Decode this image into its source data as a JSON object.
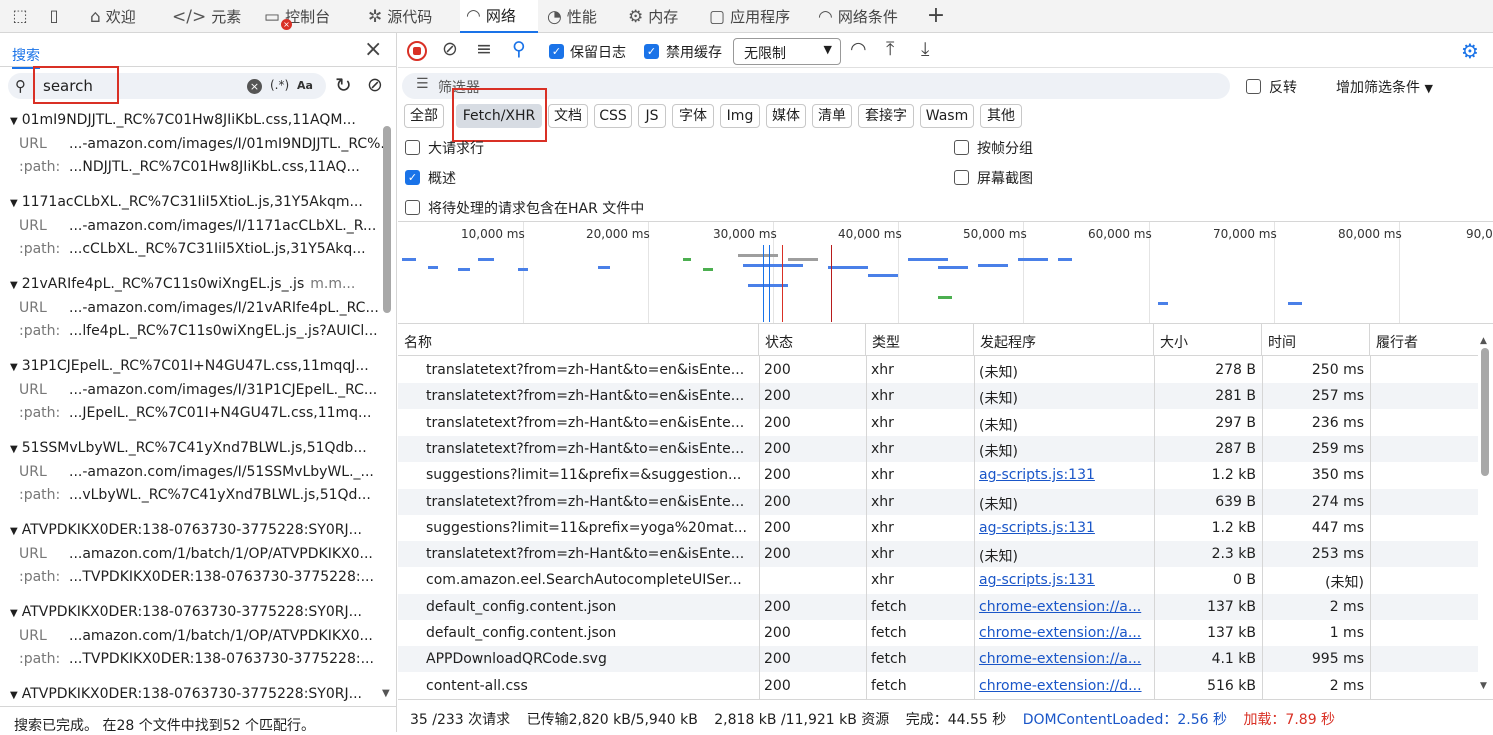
{
  "topbar": {
    "tabs": [
      {
        "label": "欢迎",
        "icon": "home-icon"
      },
      {
        "label": "元素",
        "icon": "code-icon"
      },
      {
        "label": "控制台",
        "icon": "console-icon"
      },
      {
        "label": "源代码",
        "icon": "bug-icon"
      },
      {
        "label": "网络",
        "icon": "wifi-icon"
      },
      {
        "label": "性能",
        "icon": "gauge-icon"
      },
      {
        "label": "内存",
        "icon": "chip-icon"
      },
      {
        "label": "应用程序",
        "icon": "window-icon"
      },
      {
        "label": "网络条件",
        "icon": "wifi-gear-icon"
      }
    ],
    "active_tab": "网络",
    "add_label": "+"
  },
  "search_panel": {
    "tab_label": "搜索",
    "query": "search",
    "regex_label": "(.*)",
    "case_label": "Aa",
    "results": [
      {
        "file": "01mI9NDJJTL._RC%7C01Hw8JIiKbL.css,11AQM...",
        "domain": "",
        "url": "...-amazon.com/images/I/01mI9NDJJTL._RC%...",
        "path": "...NDJJTL._RC%7C01Hw8JIiKbL.css,11AQ..."
      },
      {
        "file": "1171acCLbXL._RC%7C31IiI5XtioL.js,31Y5Akqm...",
        "domain": "",
        "url": "...-amazon.com/images/I/1171acCLbXL._R...",
        "path": "...cCLbXL._RC%7C31IiI5XtioL.js,31Y5Akq..."
      },
      {
        "file": "21vARIfe4pL._RC%7C11s0wiXngEL.js_.js",
        "domain": "m.m...",
        "url": "...-amazon.com/images/I/21vARIfe4pL._RC...",
        "path": "...lfe4pL._RC%7C11s0wiXngEL.js_.js?AUICl..."
      },
      {
        "file": "31P1CJEpelL._RC%7C01I+N4GU47L.css,11mqqJ...",
        "domain": "",
        "url": "...-amazon.com/images/I/31P1CJEpelL._RC...",
        "path": "...JEpelL._RC%7C01I+N4GU47L.css,11mq..."
      },
      {
        "file": "51SSMvLbyWL._RC%7C41yXnd7BLWL.js,51Qdb...",
        "domain": "",
        "url": "...-amazon.com/images/I/51SSMvLbyWL._...",
        "path": "...vLbyWL._RC%7C41yXnd7BLWL.js,51Qd..."
      },
      {
        "file": "ATVPDKIKX0DER:138-0763730-3775228:SY0RJ...",
        "domain": "",
        "url": "...amazon.com/1/batch/1/OP/ATVPDKIKX0...",
        "path": "...TVPDKIKX0DER:138-0763730-3775228:..."
      },
      {
        "file": "ATVPDKIKX0DER:138-0763730-3775228:SY0RJ...",
        "domain": "",
        "url": "...amazon.com/1/batch/1/OP/ATVPDKIKX0...",
        "path": "...TVPDKIKX0DER:138-0763730-3775228:..."
      },
      {
        "file": "ATVPDKIKX0DER:138-0763730-3775228:SY0RJ...",
        "domain": "",
        "url": "",
        "path": ""
      }
    ],
    "url_key": "URL",
    "path_key": ":path:",
    "status": "搜索已完成。  在28 个文件中找到52 个匹配行。"
  },
  "toolbar": {
    "preserve_log": "保留日志",
    "disable_cache": "禁用缓存",
    "throttle": "无限制"
  },
  "filter": {
    "placeholder": "筛选器",
    "invert": "反转",
    "more_filters": "增加筛选条件"
  },
  "types": [
    "全部",
    "Fetch/XHR",
    "文档",
    "CSS",
    "JS",
    "字体",
    "Img",
    "媒体",
    "清单",
    "套接字",
    "Wasm",
    "其他"
  ],
  "selected_type": "Fetch/XHR",
  "options": {
    "big_rows": {
      "label": "大请求行",
      "checked": false
    },
    "group_by_frame": {
      "label": "按帧分组",
      "checked": false
    },
    "overview": {
      "label": "概述",
      "checked": true
    },
    "screenshots": {
      "label": "屏幕截图",
      "checked": false
    },
    "har": {
      "label": "将待处理的请求包含在HAR 文件中",
      "checked": false
    }
  },
  "overview": {
    "ticks": [
      "10,000 ms",
      "20,000 ms",
      "30,000 ms",
      "40,000 ms",
      "50,000 ms",
      "60,000 ms",
      "70,000 ms",
      "80,000 ms",
      "90,0"
    ]
  },
  "table": {
    "headers": [
      "名称",
      "状态",
      "类型",
      "发起程序",
      "大小",
      "时间",
      "履行者"
    ],
    "rows": [
      {
        "name": "translatetext?from=zh-Hant&to=en&isEnte...",
        "status": "200",
        "type": "xhr",
        "initiator": "(未知)",
        "link": false,
        "size": "278 B",
        "time": "250 ms"
      },
      {
        "name": "translatetext?from=zh-Hant&to=en&isEnte...",
        "status": "200",
        "type": "xhr",
        "initiator": "(未知)",
        "link": false,
        "size": "281 B",
        "time": "257 ms"
      },
      {
        "name": "translatetext?from=zh-Hant&to=en&isEnte...",
        "status": "200",
        "type": "xhr",
        "initiator": "(未知)",
        "link": false,
        "size": "297 B",
        "time": "236 ms"
      },
      {
        "name": "translatetext?from=zh-Hant&to=en&isEnte...",
        "status": "200",
        "type": "xhr",
        "initiator": "(未知)",
        "link": false,
        "size": "287 B",
        "time": "259 ms"
      },
      {
        "name": "suggestions?limit=11&prefix=&suggestion...",
        "status": "200",
        "type": "xhr",
        "initiator": "ag-scripts.js:131",
        "link": true,
        "size": "1.2 kB",
        "time": "350 ms"
      },
      {
        "name": "translatetext?from=zh-Hant&to=en&isEnte...",
        "status": "200",
        "type": "xhr",
        "initiator": "(未知)",
        "link": false,
        "size": "639 B",
        "time": "274 ms"
      },
      {
        "name": "suggestions?limit=11&prefix=yoga%20mat...",
        "status": "200",
        "type": "xhr",
        "initiator": "ag-scripts.js:131",
        "link": true,
        "size": "1.2 kB",
        "time": "447 ms"
      },
      {
        "name": "translatetext?from=zh-Hant&to=en&isEnte...",
        "status": "200",
        "type": "xhr",
        "initiator": "(未知)",
        "link": false,
        "size": "2.3 kB",
        "time": "253 ms"
      },
      {
        "name": "com.amazon.eel.SearchAutocompleteUISer...",
        "status": "",
        "type": "xhr",
        "initiator": "ag-scripts.js:131",
        "link": true,
        "size": "0 B",
        "time": "(未知)"
      },
      {
        "name": "default_config.content.json",
        "status": "200",
        "type": "fetch",
        "initiator": "chrome-extension://a...",
        "link": true,
        "size": "137 kB",
        "time": "2 ms"
      },
      {
        "name": "default_config.content.json",
        "status": "200",
        "type": "fetch",
        "initiator": "chrome-extension://a...",
        "link": true,
        "size": "137 kB",
        "time": "1 ms"
      },
      {
        "name": "APPDownloadQRCode.svg",
        "status": "200",
        "type": "fetch",
        "initiator": "chrome-extension://a...",
        "link": true,
        "size": "4.1 kB",
        "time": "995 ms"
      },
      {
        "name": "content-all.css",
        "status": "200",
        "type": "fetch",
        "initiator": "chrome-extension://d...",
        "link": true,
        "size": "516 kB",
        "time": "2 ms"
      }
    ]
  },
  "summary": {
    "requests": "35 /233 次请求",
    "transferred": "已传输2,820 kB/5,940 kB",
    "resources": "2,818 kB /11,921 kB 资源",
    "finish": "完成：44.55 秒",
    "dcl": "DOMContentLoaded：2.56 秒",
    "load": "加载：7.89 秒"
  },
  "colors": {
    "accent": "#1a73e8",
    "red": "#d93025",
    "link": "#1a56c8"
  }
}
